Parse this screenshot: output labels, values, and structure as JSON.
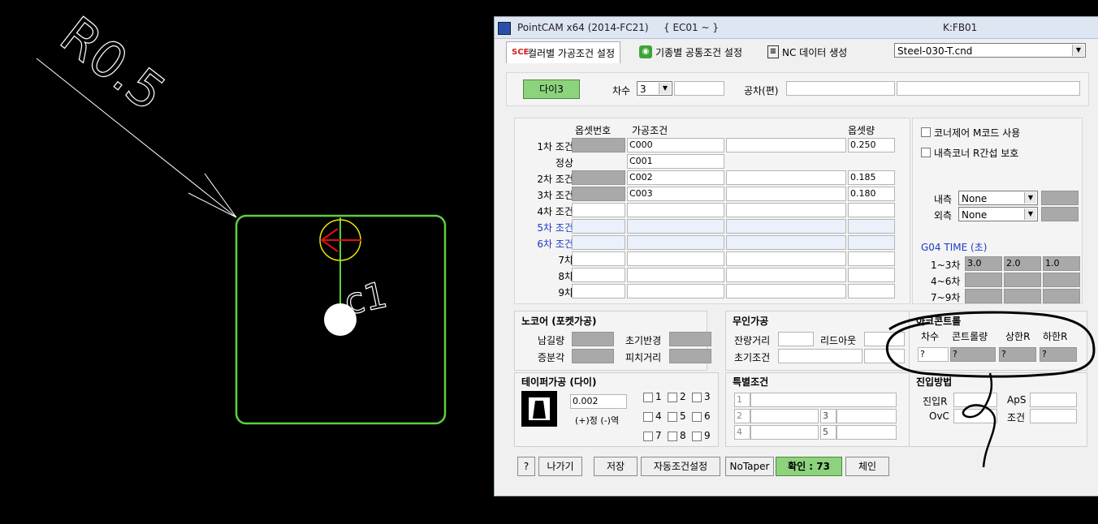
{
  "cad": {
    "radius_label": "R0.5",
    "c_label": "c1"
  },
  "title": {
    "app": "PointCAM x64 (2014-FC21)",
    "program": "{ EC01 ~ }",
    "file": "K:FB01"
  },
  "tabs": [
    {
      "icon": "SCE",
      "label": "컬러별 가공조건 설정"
    },
    {
      "icon": "rss",
      "label": "기종별 공통조건 설정"
    },
    {
      "icon": "doc",
      "label": "NC 데이터 생성"
    }
  ],
  "material_select": "Steel-030-T.cnd",
  "top": {
    "die_button": "다이3",
    "order_label": "차수",
    "order_value": "3",
    "tolerance_label": "공차(편)"
  },
  "grid": {
    "headers": {
      "offset_no": "옵셋번호",
      "condition": "가공조건",
      "offset_amount": "옵셋량"
    },
    "rows": [
      {
        "label": "1차 조건",
        "cond": "C000",
        "amount": "0.250",
        "blue": false
      },
      {
        "label": "정상",
        "cond": "C001",
        "amount": "",
        "blue": false
      },
      {
        "label": "2차 조건",
        "cond": "C002",
        "amount": "0.185",
        "blue": false
      },
      {
        "label": "3차 조건",
        "cond": "C003",
        "amount": "0.180",
        "blue": false
      },
      {
        "label": "4차 조건",
        "cond": "",
        "amount": "",
        "blue": false
      },
      {
        "label": "5차 조건",
        "cond": "",
        "amount": "",
        "blue": true
      },
      {
        "label": "6차 조건",
        "cond": "",
        "amount": "",
        "blue": true
      },
      {
        "label": "7차",
        "cond": "",
        "amount": "",
        "blue": false
      },
      {
        "label": "8차",
        "cond": "",
        "amount": "",
        "blue": false
      },
      {
        "label": "9차",
        "cond": "",
        "amount": "",
        "blue": false
      }
    ]
  },
  "right": {
    "corner_m_code": "코너제어 M코드 사용",
    "inner_r_protect": "내측코너 R간섭 보호",
    "inner_label": "내측",
    "inner_value": "None",
    "outer_label": "외측",
    "outer_value": "None",
    "g04_title": "G04 TIME (초)",
    "g04_rows": [
      {
        "label": "1~3차",
        "v1": "3.0",
        "v2": "2.0",
        "v3": "1.0"
      },
      {
        "label": "4~6차",
        "v1": "",
        "v2": "",
        "v3": ""
      },
      {
        "label": "7~9차",
        "v1": "",
        "v2": "",
        "v3": ""
      }
    ]
  },
  "nocore": {
    "title": "노코어 (포켓가공)",
    "remain": "남길량",
    "init_radius": "초기반경",
    "increment": "증분각",
    "pitch": "피치거리"
  },
  "unattended": {
    "title": "무인가공",
    "remain_dist": "잔량거리",
    "lead_out": "리드아웃",
    "init_cond": "초기조건"
  },
  "arc_control": {
    "title": "아크콘트롤",
    "order": "차수",
    "control": "콘트롤량",
    "upper_r": "상한R",
    "lower_r": "하한R",
    "values": [
      "?",
      "?",
      "?",
      "?"
    ]
  },
  "taper": {
    "title": "테이퍼가공 (다이)",
    "value": "0.002",
    "direction": "(+)정 (-)역",
    "checks": [
      "1",
      "2",
      "3",
      "4",
      "5",
      "6",
      "7",
      "8",
      "9"
    ]
  },
  "special": {
    "title": "특별조건",
    "rows": [
      "1",
      "2",
      "3",
      "4",
      "5"
    ]
  },
  "approach": {
    "title": "진입방법",
    "approach_r": "진입R",
    "aps": "ApS",
    "ovc": "OvC",
    "cond": "조건"
  },
  "bottom": {
    "help": "?",
    "exit": "나가기",
    "save": "저장",
    "auto": "자동조건설정",
    "notaper": "NoTaper",
    "confirm": "확인 : 73",
    "chain": "체인"
  },
  "colors": {
    "bg": "#000000",
    "cad_green": "#5bd13f",
    "accent_green": "#8dd37e",
    "blue_text": "#1a3cc8"
  }
}
